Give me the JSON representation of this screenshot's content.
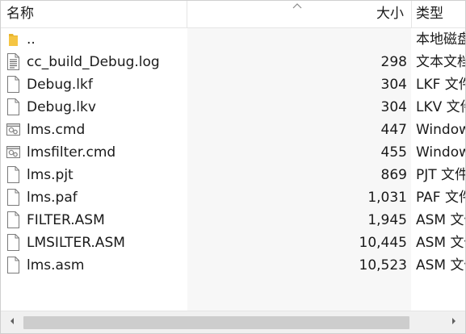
{
  "header": {
    "name_label": "名称",
    "size_label": "大小",
    "type_label": "类型",
    "sort_arrow": "^"
  },
  "files": [
    {
      "name": "..",
      "size": "",
      "type": "本地磁盘",
      "icon": "folder-icon"
    },
    {
      "name": "cc_build_Debug.log",
      "size": "298",
      "type": "文本文档",
      "icon": "text-document-icon"
    },
    {
      "name": "Debug.lkf",
      "size": "304",
      "type": "LKF 文件",
      "icon": "file-icon"
    },
    {
      "name": "Debug.lkv",
      "size": "304",
      "type": "LKV 文件",
      "icon": "file-icon"
    },
    {
      "name": "lms.cmd",
      "size": "447",
      "type": "Windows",
      "icon": "cmd-script-icon"
    },
    {
      "name": "lmsfilter.cmd",
      "size": "455",
      "type": "Windows",
      "icon": "cmd-script-icon"
    },
    {
      "name": "lms.pjt",
      "size": "869",
      "type": "PJT 文件",
      "icon": "file-icon"
    },
    {
      "name": "lms.paf",
      "size": "1,031",
      "type": "PAF 文件",
      "icon": "file-icon"
    },
    {
      "name": "FILTER.ASM",
      "size": "1,945",
      "type": "ASM 文件",
      "icon": "file-icon"
    },
    {
      "name": "LMSILTER.ASM",
      "size": "10,445",
      "type": "ASM 文件",
      "icon": "file-icon"
    },
    {
      "name": "lms.asm",
      "size": "10,523",
      "type": "ASM 文件",
      "icon": "file-icon"
    }
  ],
  "colors": {
    "folder": "#f5c543",
    "scroll_thumb": "#cdcdcd",
    "size_column_bg": "#f7f7f7"
  }
}
